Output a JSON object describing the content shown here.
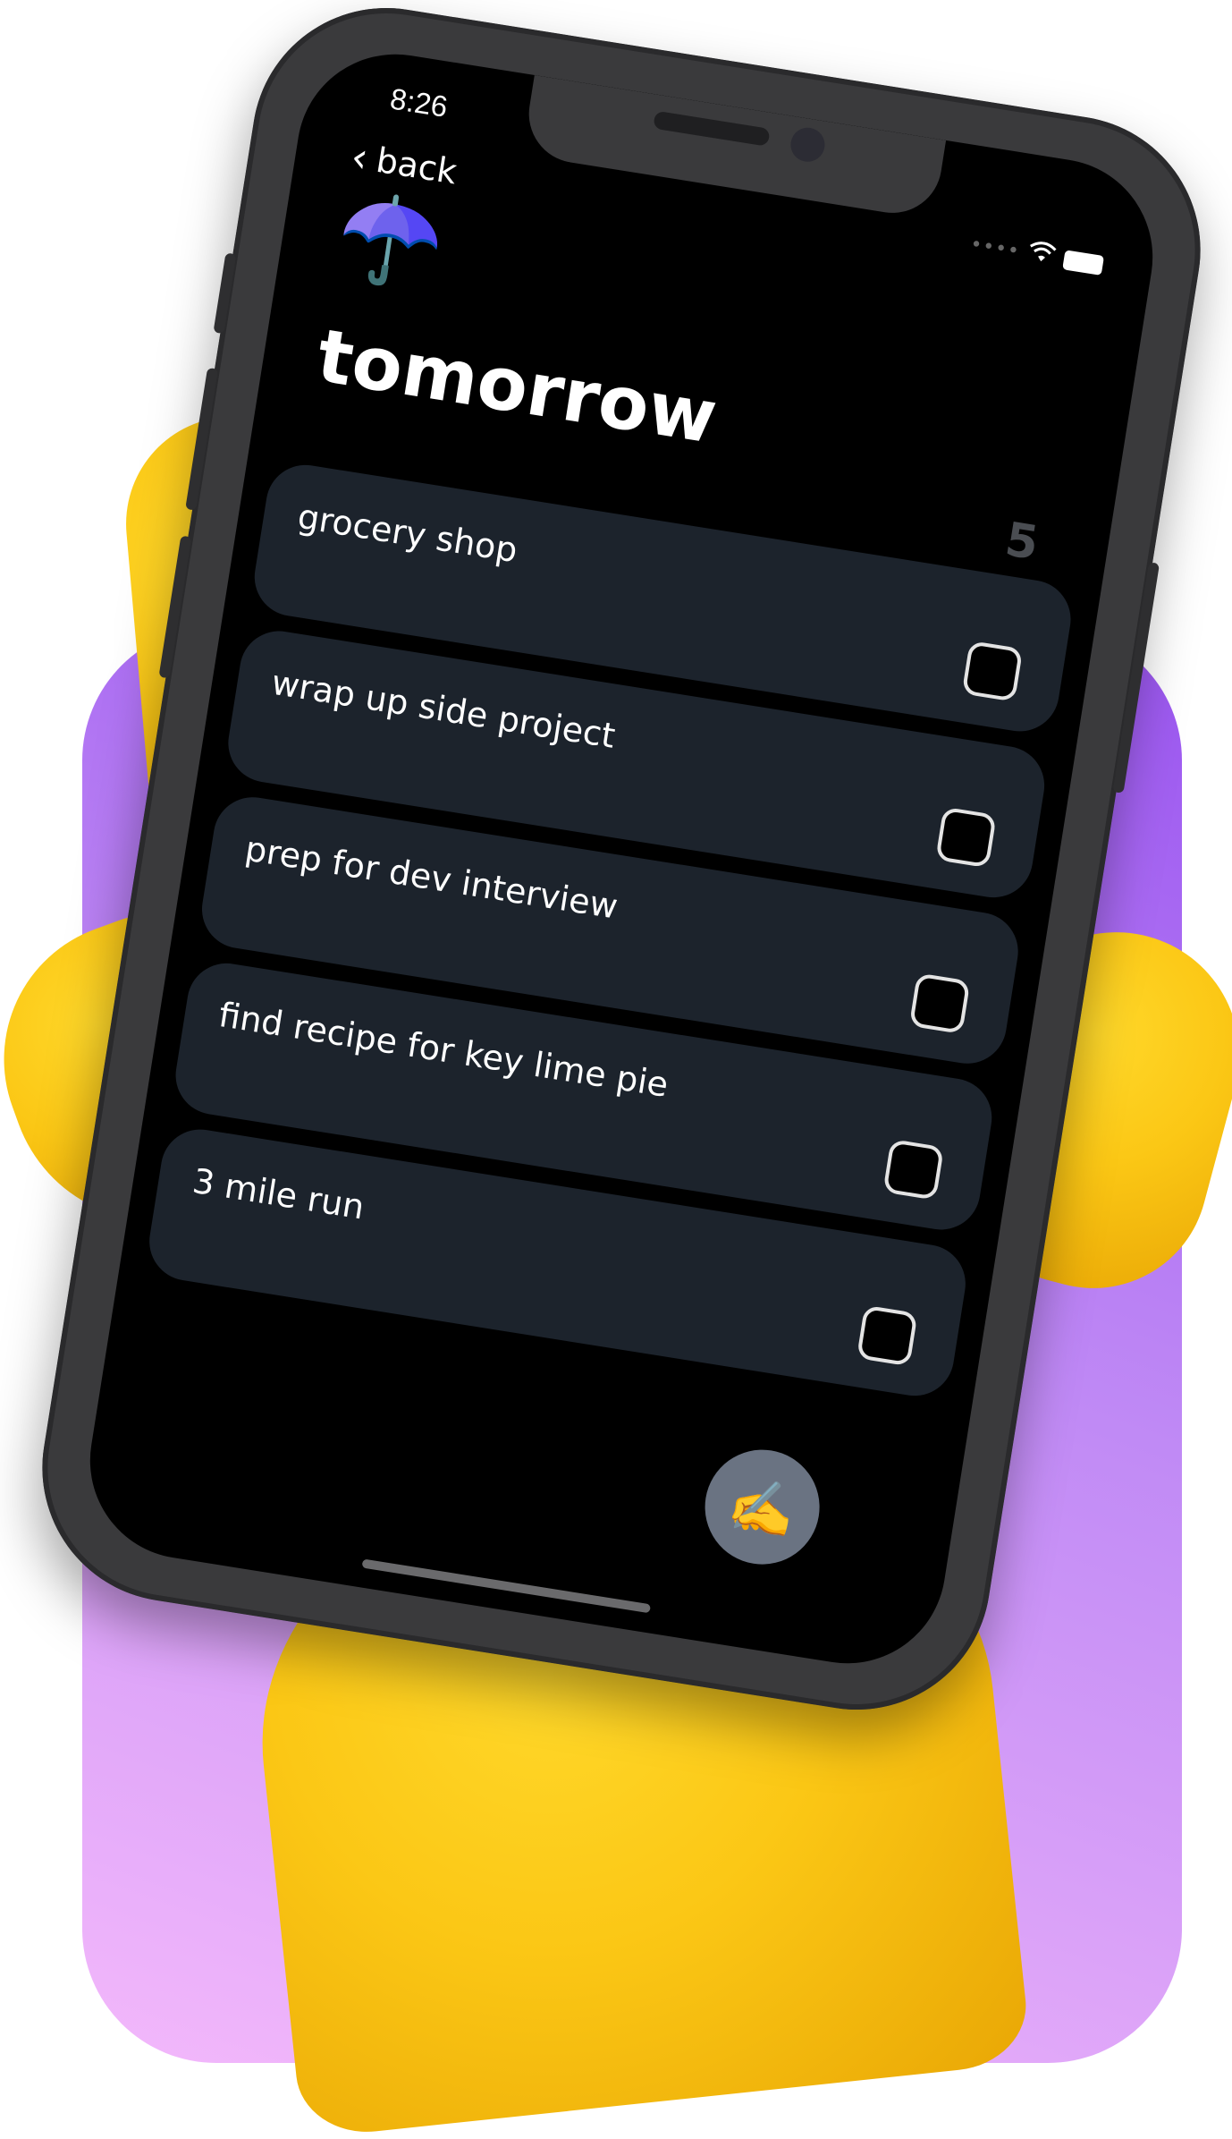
{
  "status_bar": {
    "time": "8:26",
    "signal_icon": "signal-dots-icon",
    "wifi_icon": "wifi-icon",
    "battery_icon": "battery-icon"
  },
  "nav": {
    "back_label": "back",
    "back_icon": "chevron-left-icon"
  },
  "list": {
    "emoji": "☂️",
    "title": "tomorrow",
    "count": "5",
    "tasks": [
      {
        "label": "grocery shop",
        "checked": false
      },
      {
        "label": "wrap up side project",
        "checked": false
      },
      {
        "label": "prep for dev interview",
        "checked": false
      },
      {
        "label": "find recipe for key lime pie",
        "checked": false
      },
      {
        "label": "3 mile run",
        "checked": false
      }
    ]
  },
  "compose_button": {
    "emoji": "✍️",
    "color": "#6a7382"
  },
  "colors": {
    "background_gradient": [
      "#9a55f0",
      "#f3b8fb"
    ],
    "task_card": "#1c232c",
    "hand": "#fbc715"
  }
}
